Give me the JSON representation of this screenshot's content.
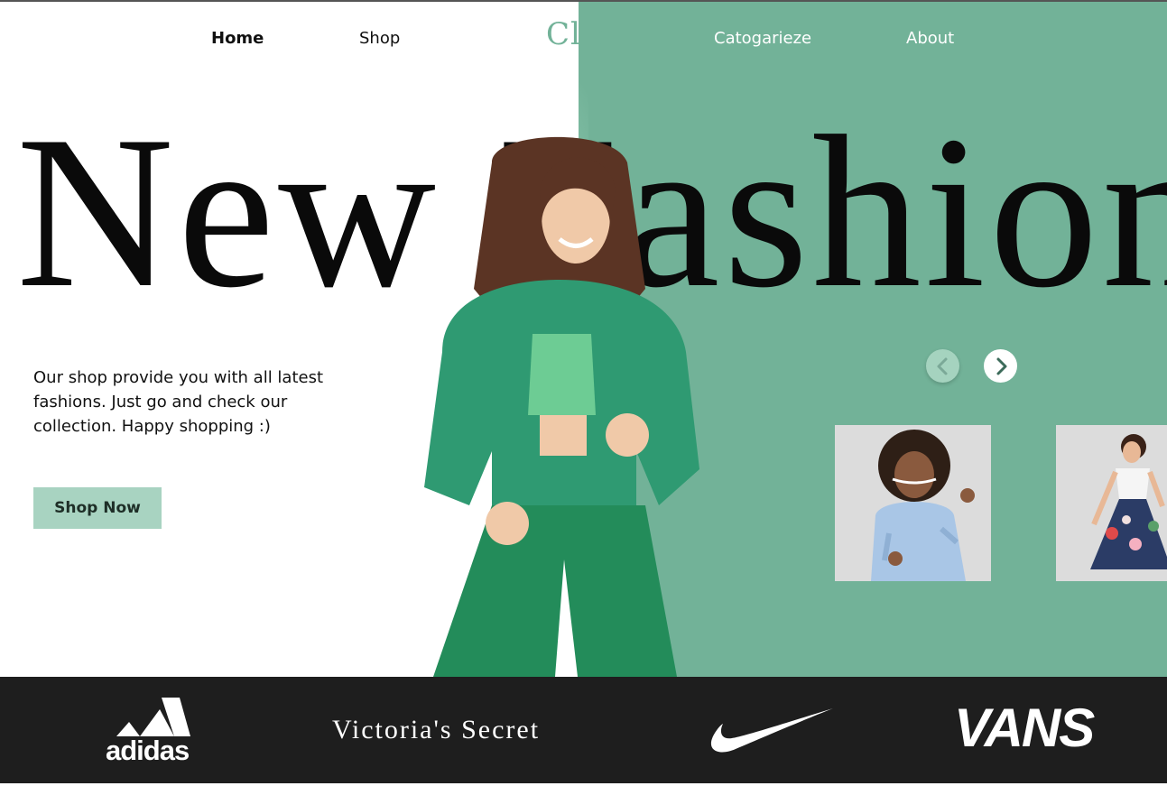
{
  "nav": {
    "home": "Home",
    "shop": "Shop",
    "logo": "Clra",
    "categorize": "Catogarieze",
    "about": "About"
  },
  "hero": {
    "headline": "New Fashion",
    "description": "Our shop provide you with all latest fashions. Just go and check  our collection. Happy shopping :)",
    "cta_label": "Shop Now"
  },
  "colors": {
    "accent_green": "#72b298",
    "button_green": "#a8d3c1",
    "brand_bar": "#1e1e1e"
  },
  "carousel": {
    "prev_icon": "chevron-left-icon",
    "next_icon": "chevron-right-icon"
  },
  "brands": {
    "adidas": "adidas",
    "victorias_secret": "Victoria's Secret",
    "nike": "nike-swoosh-icon",
    "vans": "VANS"
  }
}
